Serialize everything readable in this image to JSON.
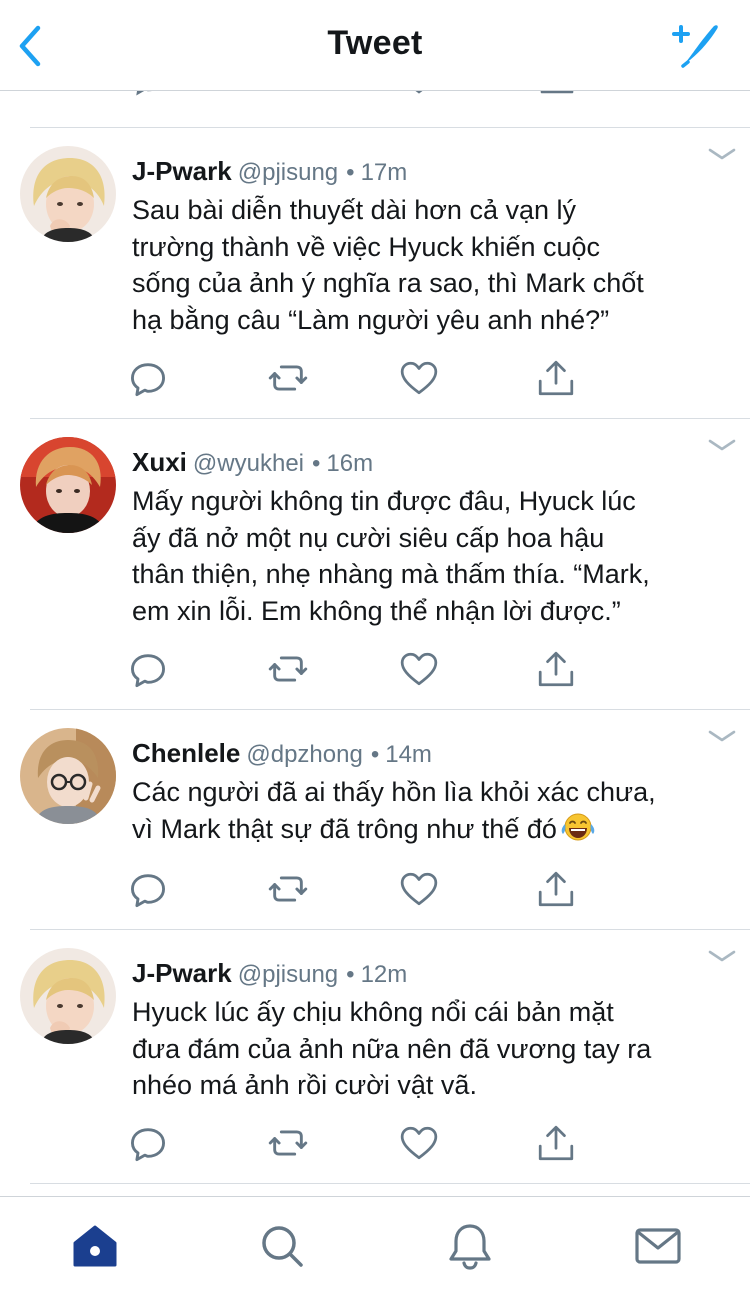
{
  "header": {
    "title": "Tweet"
  },
  "icons": {
    "back": "chevron-left-icon",
    "compose": "compose-tweet-icon",
    "reply": "reply-icon",
    "retweet": "retweet-icon",
    "like": "heart-icon",
    "share": "share-icon",
    "caret": "chevron-down-icon",
    "home": "home-icon",
    "search": "search-icon",
    "notifications": "bell-icon",
    "messages": "mail-icon"
  },
  "colors": {
    "accent": "#1da1f2",
    "home_active": "#1b3f8f",
    "muted": "#657786",
    "text": "#14171a"
  },
  "tweets": [
    {
      "name": "J-Pwark",
      "handle": "@pjisung",
      "time": "17m",
      "text": "Sau bài diễn thuyết dài hơn cả vạn lý\ntrường thành về việc Hyuck khiến cuộc\nsống của ảnh ý nghĩa ra sao, thì Mark chốt\nhạ bằng câu “Làm người yêu anh nhé?”"
    },
    {
      "name": "Xuxi",
      "handle": "@wyukhei",
      "time": "16m",
      "text": "Mấy người không tin được đâu, Hyuck lúc\nấy đã nở một nụ cười siêu cấp hoa hậu\nthân thiện, nhẹ nhàng mà thấm thía. “Mark,\nem xin lỗi. Em không thể nhận lời được.”"
    },
    {
      "name": "Chenlele",
      "handle": "@dpzhong",
      "time": "14m",
      "text": "Các người đã ai thấy hồn lìa khỏi xác chưa,\nvì Mark thật sự đã trông như thế đó",
      "emoji": "face-with-tears-of-joy"
    },
    {
      "name": "J-Pwark",
      "handle": "@pjisung",
      "time": "12m",
      "text": "Hyuck lúc ấy chịu không nổi cái bản mặt\nđưa đám của ảnh nữa nên đã vương tay ra\nnhéo má ảnh rồi cười vật vã."
    }
  ]
}
